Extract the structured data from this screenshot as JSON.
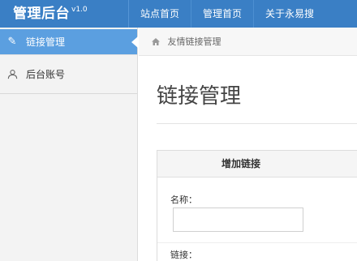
{
  "header": {
    "brand": "管理后台",
    "version": "v1.0",
    "nav": [
      "站点首页",
      "管理首页",
      "关于永易搜"
    ],
    "color": "#3a7fc5"
  },
  "sidebar": {
    "items": [
      {
        "label": "链接管理",
        "icon": "pen-icon",
        "active": true
      },
      {
        "label": "后台账号",
        "icon": "user-icon",
        "active": false
      }
    ],
    "active_color": "#5b9fe0"
  },
  "breadcrumb": {
    "icon": "home-icon",
    "label": "友情链接管理"
  },
  "main": {
    "title": "链接管理",
    "panel": {
      "heading": "增加链接",
      "name_label": "名称：",
      "name_value": "",
      "link_label": "链接："
    }
  }
}
